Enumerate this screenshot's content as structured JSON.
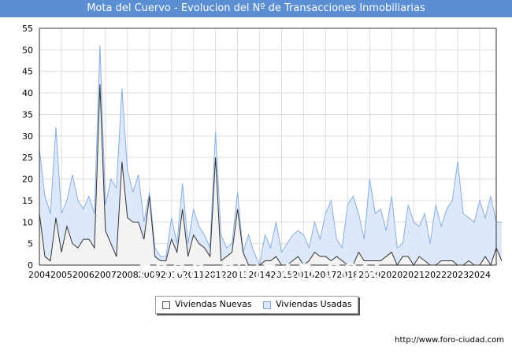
{
  "header": {
    "title": "Mota del Cuervo - Evolucion del Nº de Transacciones Inmobiliarias"
  },
  "footer": {
    "url": "http://www.foro-ciudad.com"
  },
  "watermark": {
    "text": "FORO-CIUDAD.COM"
  },
  "legend": {
    "placement": "bottom-center"
  },
  "colors": {
    "title_bar": "#5b8ed2",
    "nuevas_fill": "#f3f3f3",
    "usadas_fill": "#dde9fa",
    "usadas_line": "#88aee0",
    "nuevas_line": "#333333",
    "grid": "#dddddd"
  },
  "chart_data": {
    "type": "area",
    "title": "Mota del Cuervo - Evolucion del Nº de Transacciones Inmobiliarias",
    "xlabel": "",
    "ylabel": "",
    "ylim": [
      0,
      55
    ],
    "xlim": [
      2004,
      2024.75
    ],
    "y_ticks": [
      0,
      5,
      10,
      15,
      20,
      25,
      30,
      35,
      40,
      45,
      50,
      55
    ],
    "x_ticks": [
      "2004",
      "2005",
      "2006",
      "2007",
      "2008",
      "2009",
      "2010",
      "2011",
      "2012",
      "2013",
      "2014",
      "2015",
      "2016",
      "2017",
      "2018",
      "2019",
      "2020",
      "2021",
      "2022",
      "2023",
      "2024"
    ],
    "grid": true,
    "x_start_year": 2004,
    "points_per_year": 4,
    "series": [
      {
        "name": "Viviendas Nuevas",
        "values": [
          12,
          2,
          1,
          11,
          3,
          9,
          5,
          4,
          6,
          6,
          4,
          42,
          8,
          5,
          2,
          24,
          11,
          10,
          10,
          6,
          16,
          2,
          1,
          1,
          6,
          3,
          13,
          2,
          7,
          5,
          4,
          2,
          25,
          1,
          2,
          3,
          13,
          3,
          0,
          0,
          0,
          1,
          1,
          2,
          0,
          0,
          1,
          2,
          0,
          1,
          3,
          2,
          2,
          1,
          2,
          1,
          0,
          0,
          3,
          1,
          1,
          1,
          1,
          2,
          3,
          0,
          2,
          2,
          0,
          2,
          1,
          0,
          0,
          1,
          1,
          1,
          0,
          0,
          1,
          0,
          0,
          2,
          0,
          4,
          1
        ]
      },
      {
        "name": "Viviendas Usadas",
        "values": [
          27,
          16,
          12,
          32,
          12,
          15,
          21,
          15,
          13,
          16,
          12,
          51,
          14,
          20,
          18,
          41,
          22,
          17,
          21,
          10,
          17,
          4,
          2,
          2,
          11,
          5,
          19,
          5,
          13,
          9,
          7,
          4,
          31,
          7,
          4,
          5,
          17,
          3,
          7,
          3,
          0,
          7,
          4,
          10,
          3,
          5,
          7,
          8,
          7,
          4,
          10,
          6,
          12,
          15,
          6,
          4,
          14,
          16,
          12,
          6,
          20,
          12,
          13,
          8,
          16,
          4,
          5,
          14,
          10,
          9,
          12,
          5,
          14,
          9,
          13,
          15,
          24,
          12,
          11,
          10,
          15,
          11,
          16,
          10,
          10
        ]
      }
    ]
  }
}
